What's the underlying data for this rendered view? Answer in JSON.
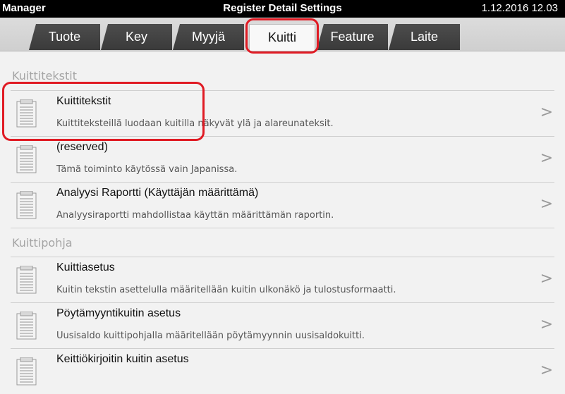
{
  "titlebar": {
    "app_name": "Manager",
    "title": "Register Detail Settings",
    "datetime": "1.12.2016 12.03"
  },
  "tabs": [
    {
      "label": "Tuote"
    },
    {
      "label": "Key"
    },
    {
      "label": "Myyjä"
    },
    {
      "label": "Kuitti",
      "active": true
    },
    {
      "label": "Feature"
    },
    {
      "label": "Laite"
    }
  ],
  "sections": [
    {
      "header": "Kuittitekstit",
      "items": [
        {
          "title": "Kuittitekstit",
          "description": "Kuittiteksteillä luodaan kuitilla näkyvät ylä ja alareunateksit."
        },
        {
          "title": "(reserved)",
          "description": "Tämä toiminto käytössä vain Japanissa."
        },
        {
          "title": "Analyysi Raportti (Käyttäjän määrittämä)",
          "description": "Analyysiraportti mahdollistaa käyttän määrittämän raportin."
        }
      ]
    },
    {
      "header": "Kuittipohja",
      "items": [
        {
          "title": "Kuittiasetus",
          "description": "Kuitin tekstin asettelulla määritellään kuitin ulkonäkö ja tulostusformaatti."
        },
        {
          "title": "Pöytämyyntikuitin asetus",
          "description": "Uusisaldo kuittipohjalla määritellään pöytämyynnin uusisaldokuitti."
        },
        {
          "title": "Keittiökirjoitin kuitin asetus",
          "description": ""
        }
      ]
    }
  ],
  "icons": {
    "item_icon": "document-icon",
    "chevron": ">"
  },
  "colors": {
    "highlight": "#e01b24",
    "tab_bg": "#404040",
    "section_header": "#a5a5a5"
  }
}
